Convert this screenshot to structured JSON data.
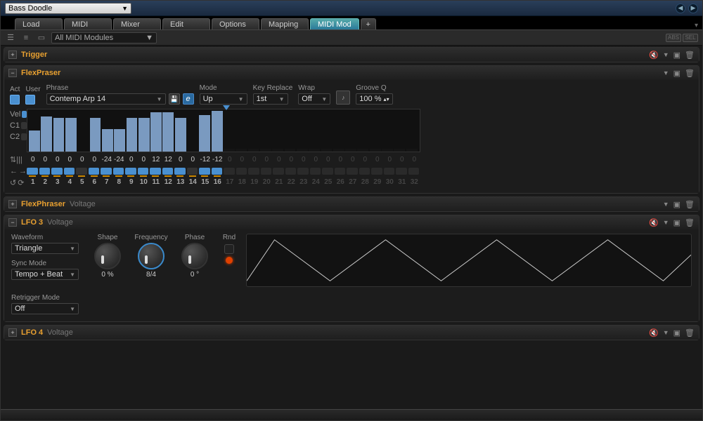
{
  "preset": "Bass Doodle",
  "tabs": [
    "Load",
    "MIDI",
    "Mixer",
    "Edit",
    "Options",
    "Mapping",
    "MIDI Mod"
  ],
  "active_tab": "MIDI Mod",
  "add_tab_label": "+",
  "module_filter": "All MIDI Modules",
  "badges": [
    "ABS",
    "SEL"
  ],
  "trigger": {
    "title": "Trigger"
  },
  "flexpraser": {
    "title": "FlexPraser",
    "labels": {
      "act": "Act",
      "user": "User",
      "phrase": "Phrase",
      "mode": "Mode",
      "keyrep": "Key Replace",
      "wrap": "Wrap",
      "grooveq": "Groove Q"
    },
    "phrase": "Contemp Arp 14",
    "mode": "Up",
    "key_replace": "1st",
    "wrap": "Off",
    "groove_q": "100 %",
    "vel_label": "Vel",
    "c1_label": "C1",
    "c2_label": "C2",
    "vel_heights": [
      30,
      50,
      48,
      48,
      0,
      48,
      32,
      32,
      48,
      48,
      56,
      56,
      48,
      0,
      52,
      58,
      4,
      4,
      4,
      4,
      4,
      4,
      4,
      4,
      4,
      4,
      4,
      4,
      4,
      4,
      4,
      4
    ],
    "step_transpose": [
      0,
      0,
      0,
      0,
      0,
      0,
      -24,
      -24,
      0,
      0,
      12,
      12,
      0,
      0,
      -12,
      -12,
      0,
      0,
      0,
      0,
      0,
      0,
      0,
      0,
      0,
      0,
      0,
      0,
      0,
      0,
      0,
      0
    ],
    "step_on": [
      true,
      true,
      true,
      true,
      false,
      true,
      true,
      true,
      true,
      true,
      true,
      true,
      true,
      false,
      true,
      true,
      false,
      false,
      false,
      false,
      false,
      false,
      false,
      false,
      false,
      false,
      false,
      false,
      false,
      false,
      false,
      false
    ],
    "active_steps": 16,
    "total_steps": 32
  },
  "flexphraser": {
    "title": "FlexPhraser",
    "subtitle": "Voltage"
  },
  "lfo3": {
    "title": "LFO 3",
    "subtitle": "Voltage",
    "waveform_label": "Waveform",
    "waveform": "Triangle",
    "sync_label": "Sync Mode",
    "sync": "Tempo + Beat",
    "retrig_label": "Retrigger Mode",
    "retrig": "Off",
    "shape_label": "Shape",
    "shape_val": "0 %",
    "freq_label": "Frequency",
    "freq_val": "8/4",
    "phase_label": "Phase",
    "phase_val": "0 °",
    "rnd_label": "Rnd"
  },
  "lfo4": {
    "title": "LFO 4",
    "subtitle": "Voltage"
  }
}
